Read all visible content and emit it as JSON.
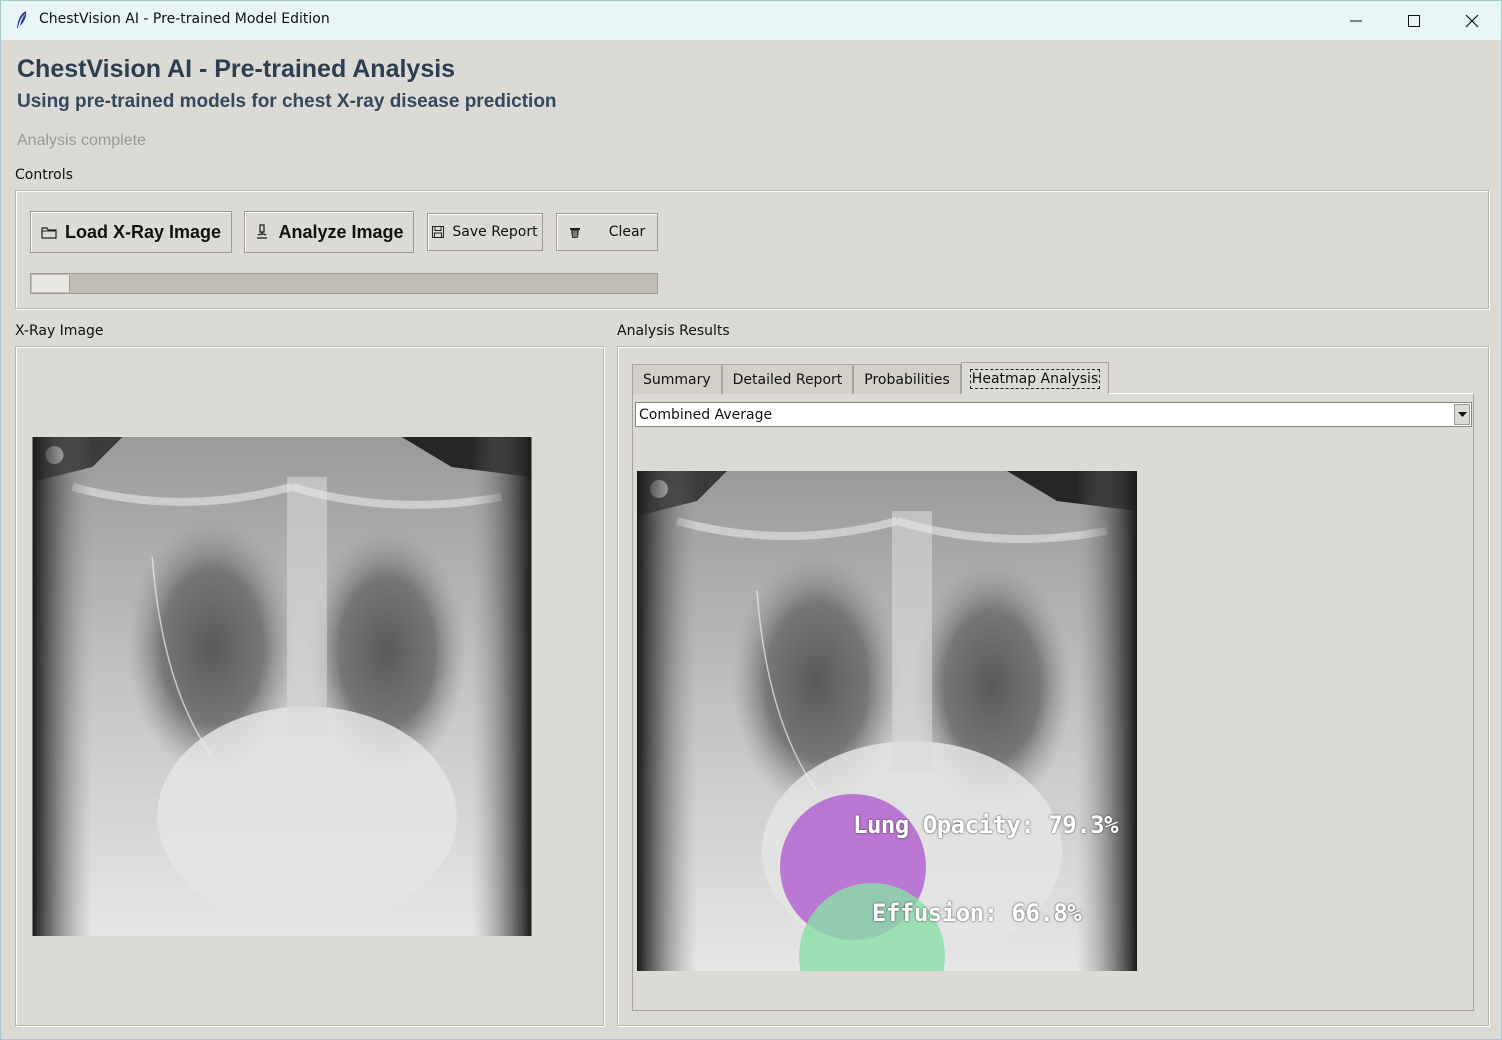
{
  "window": {
    "title": "ChestVision AI - Pre-trained Model Edition"
  },
  "header": {
    "title": "ChestVision AI - Pre-trained Analysis",
    "subtitle": "Using pre-trained models for chest X-ray disease prediction",
    "status": "Analysis complete"
  },
  "controls": {
    "group_label": "Controls",
    "load_label": "Load X-Ray Image",
    "analyze_label": "Analyze Image",
    "save_label": "Save Report",
    "clear_label": "Clear",
    "progress_fraction": 0.06
  },
  "xray_panel": {
    "label": "X-Ray Image"
  },
  "results_panel": {
    "label": "Analysis Results",
    "tabs": [
      {
        "label": "Summary"
      },
      {
        "label": "Detailed Report"
      },
      {
        "label": "Probabilities"
      },
      {
        "label": "Heatmap Analysis"
      }
    ],
    "active_tab": "Heatmap Analysis",
    "heatmap_select": "Combined Average",
    "findings": [
      {
        "label": "Lung Opacity: 79.3%",
        "color": "#b05bd0"
      },
      {
        "label": "Effusion: 66.8%",
        "color": "#8ae0a8"
      }
    ]
  }
}
